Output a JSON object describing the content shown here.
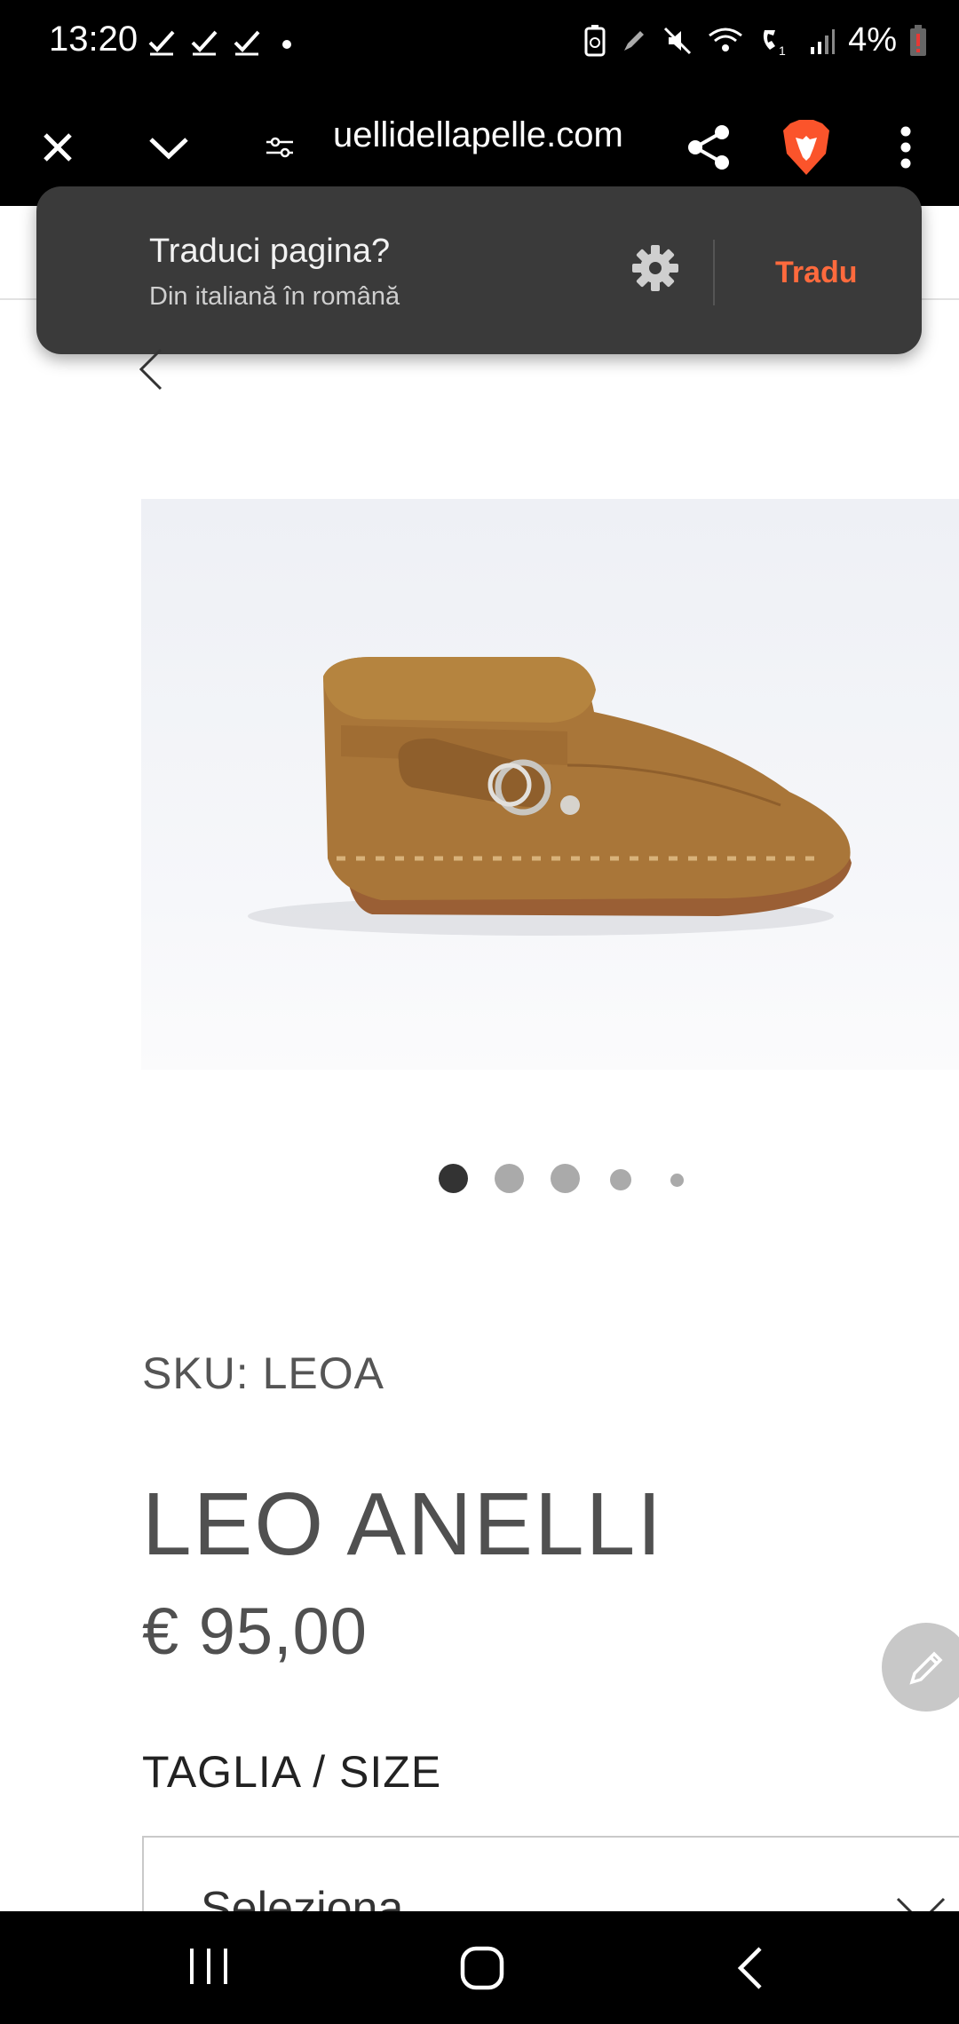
{
  "status_bar": {
    "time": "13:20",
    "battery": "4%",
    "icons": [
      "check-icon",
      "check-icon",
      "check-icon",
      "dot-icon",
      "battery-saver-icon",
      "pen-icon",
      "mute-icon",
      "wifi-calling-icon",
      "volte-icon",
      "signal-icon",
      "battery-low-icon"
    ]
  },
  "toolbar": {
    "url": "uellidellapelle.com",
    "icons": [
      "close-icon",
      "chevron-down-icon",
      "site-settings-icon",
      "share-icon",
      "brave-lion-icon",
      "more-vert-icon"
    ]
  },
  "translate_popup": {
    "title": "Traduci pagina?",
    "subtitle": "Din italiană în română",
    "action": "Tradu",
    "accent_color": "#ff6a3d"
  },
  "carousel": {
    "active_index": 0,
    "count": 5
  },
  "product": {
    "sku": "SKU: LEOA",
    "name": "LEO ANELLI",
    "price": "€ 95,00",
    "size_label": "TAGLIA / SIZE",
    "size_select_value": "Seleziona"
  },
  "nav_bar": {
    "icons": [
      "recent-apps-icon",
      "home-icon",
      "back-icon"
    ]
  }
}
